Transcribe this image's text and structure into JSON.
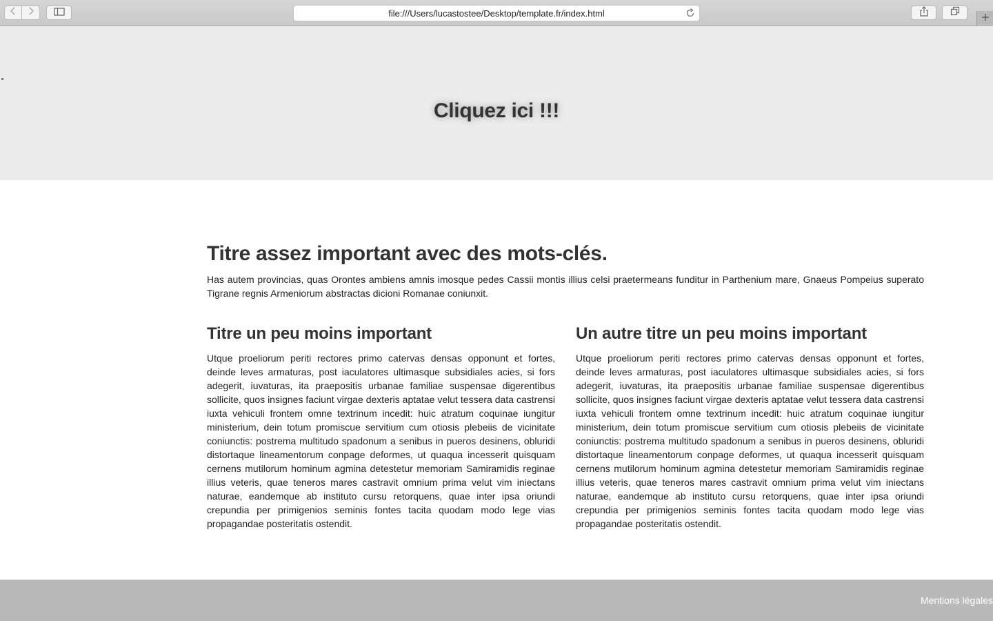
{
  "browser": {
    "url": "file:///Users/lucastostee/Desktop/template.fr/index.html",
    "icons": {
      "back": "chevron-left-icon",
      "forward": "chevron-right-icon",
      "sidebar": "sidebar-icon",
      "reload": "reload-icon",
      "share": "share-icon",
      "tabs": "tabs-icon",
      "new_tab": "plus-icon"
    }
  },
  "hero": {
    "link_label": "Cliquez ici !!!"
  },
  "content": {
    "title": "Titre assez important avec des mots-clés.",
    "intro": "Has autem provincias, quas Orontes ambiens amnis imosque pedes Cassii montis illius celsi praetermeans funditur in Parthenium mare, Gnaeus Pompeius superato Tigrane regnis Armeniorum abstractas dicioni Romanae coniunxit.",
    "columns": [
      {
        "title": "Titre un peu moins important",
        "text": "Utque proeliorum periti rectores primo catervas densas opponunt et fortes, deinde leves armaturas, post iaculatores ultimasque subsidiales acies, si fors adegerit, iuvaturas, ita praepositis urbanae familiae suspensae digerentibus sollicite, quos insignes faciunt virgae dexteris aptatae velut tessera data castrensi iuxta vehiculi frontem omne textrinum incedit: huic atratum coquinae iungitur ministerium, dein totum promiscue servitium cum otiosis plebeiis de vicinitate coniunctis: postrema multitudo spadonum a senibus in pueros desinens, obluridi distortaque lineamentorum conpage deformes, ut quaqua incesserit quisquam cernens mutilorum hominum agmina detestetur memoriam Samiramidis reginae illius veteris, quae teneros mares castravit omnium prima velut vim iniectans naturae, eandemque ab instituto cursu retorquens, quae inter ipsa oriundi crepundia per primigenios seminis fontes tacita quodam modo lege vias propagandae posteritatis ostendit."
      },
      {
        "title": "Un autre titre un peu moins important",
        "text": "Utque proeliorum periti rectores primo catervas densas opponunt et fortes, deinde leves armaturas, post iaculatores ultimasque subsidiales acies, si fors adegerit, iuvaturas, ita praepositis urbanae familiae suspensae digerentibus sollicite, quos insignes faciunt virgae dexteris aptatae velut tessera data castrensi iuxta vehiculi frontem omne textrinum incedit: huic atratum coquinae iungitur ministerium, dein totum promiscue servitium cum otiosis plebeiis de vicinitate coniunctis: postrema multitudo spadonum a senibus in pueros desinens, obluridi distortaque lineamentorum conpage deformes, ut quaqua incesserit quisquam cernens mutilorum hominum agmina detestetur memoriam Samiramidis reginae illius veteris, quae teneros mares castravit omnium prima velut vim iniectans naturae, eandemque ab instituto cursu retorquens, quae inter ipsa oriundi crepundia per primigenios seminis fontes tacita quodam modo lege vias propagandae posteritatis ostendit."
      }
    ]
  },
  "footer": {
    "legal_label": "Mentions légales"
  },
  "colors": {
    "hero_background": "#ececec",
    "footer_background": "#b9b9b9",
    "text": "#333333"
  }
}
